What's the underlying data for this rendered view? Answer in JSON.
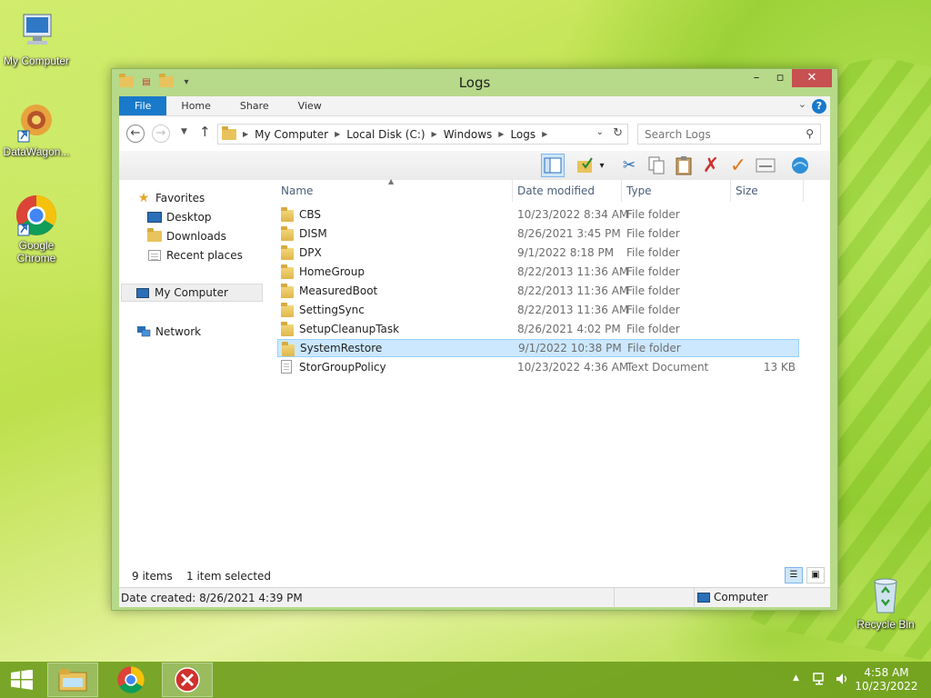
{
  "desktop": {
    "icons": [
      {
        "label": "My Computer"
      },
      {
        "label": "DataWagon..."
      },
      {
        "label": "Google Chrome"
      },
      {
        "label": "Recycle Bin"
      }
    ]
  },
  "window": {
    "title": "Logs",
    "ribbon_tabs": [
      "File",
      "Home",
      "Share",
      "View"
    ],
    "help": "?",
    "address": {
      "breadcrumbs": [
        "My Computer",
        "Local Disk (C:)",
        "Windows",
        "Logs"
      ]
    },
    "search": {
      "placeholder": "Search Logs"
    },
    "nav": {
      "favorites": "Favorites",
      "desktop": "Desktop",
      "downloads": "Downloads",
      "recent": "Recent places",
      "my_computer": "My Computer",
      "network": "Network"
    },
    "columns": {
      "name": "Name",
      "date": "Date modified",
      "type": "Type",
      "size": "Size"
    },
    "files": [
      {
        "name": "CBS",
        "date": "10/23/2022 8:34 AM",
        "type": "File folder",
        "size": "",
        "kind": "folder"
      },
      {
        "name": "DISM",
        "date": "8/26/2021 3:45 PM",
        "type": "File folder",
        "size": "",
        "kind": "folder"
      },
      {
        "name": "DPX",
        "date": "9/1/2022 8:18 PM",
        "type": "File folder",
        "size": "",
        "kind": "folder"
      },
      {
        "name": "HomeGroup",
        "date": "8/22/2013 11:36 AM",
        "type": "File folder",
        "size": "",
        "kind": "folder"
      },
      {
        "name": "MeasuredBoot",
        "date": "8/22/2013 11:36 AM",
        "type": "File folder",
        "size": "",
        "kind": "folder"
      },
      {
        "name": "SettingSync",
        "date": "8/22/2013 11:36 AM",
        "type": "File folder",
        "size": "",
        "kind": "folder"
      },
      {
        "name": "SetupCleanupTask",
        "date": "8/26/2021 4:02 PM",
        "type": "File folder",
        "size": "",
        "kind": "folder"
      },
      {
        "name": "SystemRestore",
        "date": "9/1/2022 10:38 PM",
        "type": "File folder",
        "size": "",
        "kind": "folder",
        "selected": true
      },
      {
        "name": "StorGroupPolicy",
        "date": "10/23/2022 4:36 AM",
        "type": "Text Document",
        "size": "13 KB",
        "kind": "text"
      }
    ],
    "status": {
      "item_count": "9 items",
      "selected": "1 item selected",
      "date_created": "Date created: 8/26/2021 4:39 PM",
      "location": "Computer"
    }
  },
  "taskbar": {
    "clock_time": "4:58 AM",
    "clock_date": "10/23/2022"
  },
  "colors": {
    "accent": "#1979ca",
    "selection": "#cce8ff",
    "window_frame": "#b7d98a",
    "taskbar": "#70a01e"
  }
}
